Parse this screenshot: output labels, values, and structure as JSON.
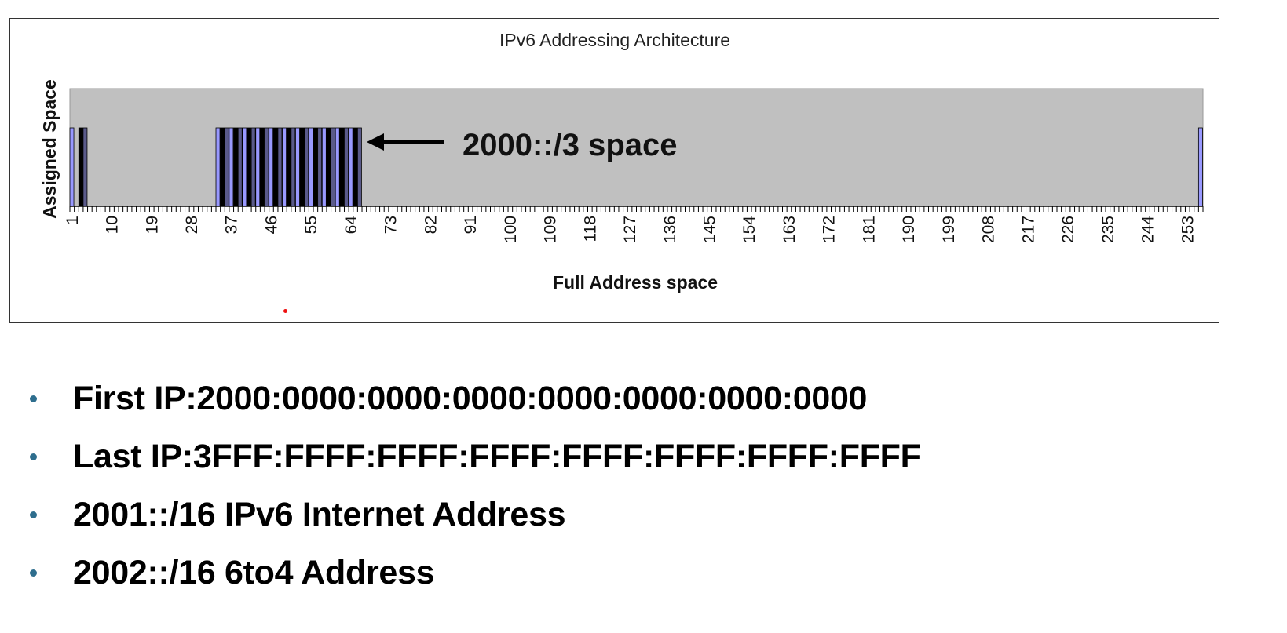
{
  "chart_data": {
    "type": "bar",
    "title": "IPv6 Addressing Architecture",
    "xlabel": "Full Address space",
    "ylabel": "Assigned Space",
    "x_range": [
      1,
      256
    ],
    "ylim": [
      0,
      1.5
    ],
    "grid": false,
    "legend": "none",
    "tick_labels": [
      "1",
      "10",
      "19",
      "28",
      "37",
      "46",
      "55",
      "64",
      "73",
      "82",
      "91",
      "100",
      "109",
      "118",
      "127",
      "136",
      "145",
      "154",
      "163",
      "172",
      "181",
      "190",
      "199",
      "208",
      "217",
      "226",
      "235",
      "244",
      "253"
    ],
    "assigned_categories": [
      1,
      3,
      4,
      34,
      35,
      36,
      37,
      38,
      39,
      40,
      41,
      42,
      43,
      44,
      45,
      46,
      47,
      48,
      49,
      50,
      51,
      52,
      53,
      54,
      55,
      56,
      57,
      58,
      59,
      60,
      61,
      62,
      63,
      64,
      65,
      66,
      256
    ],
    "assigned_value": 1,
    "bar_colors": [
      "#9999ff",
      "#000000",
      "#5a5a8a"
    ],
    "plot_background": "#c0c0c0",
    "annotation": {
      "text": "2000::/3 space",
      "points_to": "assigned block 34-66",
      "arrow": "left-arrow"
    }
  },
  "bullets": [
    {
      "text": "First IP:2000:0000:0000:0000:0000:0000:0000:0000"
    },
    {
      "text": "Last IP:3FFF:FFFF:FFFF:FFFF:FFFF:FFFF:FFFF:FFFF"
    },
    {
      "text": "2001::/16  IPv6 Internet Address"
    },
    {
      "text": "2002::/16  6to4 Address"
    }
  ],
  "colors": {
    "bullet": "#2e6e8e",
    "pointer_dot": "#ee1111"
  }
}
